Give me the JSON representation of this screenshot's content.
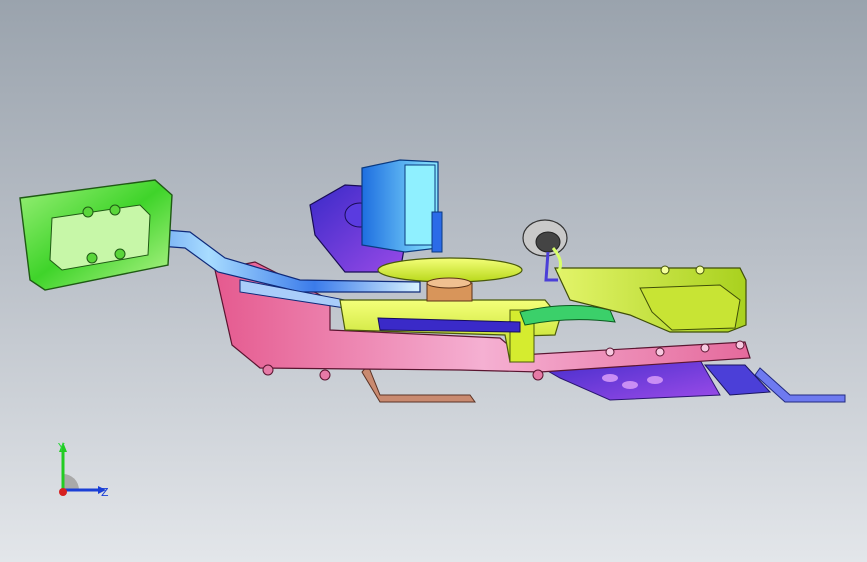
{
  "viewport": {
    "background": "gradient-gray"
  },
  "triad": {
    "y_label": "Y",
    "z_label": "Z",
    "y_color": "#22cc22",
    "z_color": "#1a3fd6",
    "x_color": "#d62020"
  },
  "model": {
    "description_icon": "cad-assembly-icon",
    "colors": {
      "pedal": "#4cd82b",
      "arm": "#3a6ee8",
      "base": "#e86a9a",
      "yellow": "#d7ee2a",
      "purple": "#7c3ae0",
      "cyan": "#49c9f0",
      "gear": "#3bd06a",
      "bronze": "#c07a3a",
      "bracket": "#8a5a40"
    }
  }
}
